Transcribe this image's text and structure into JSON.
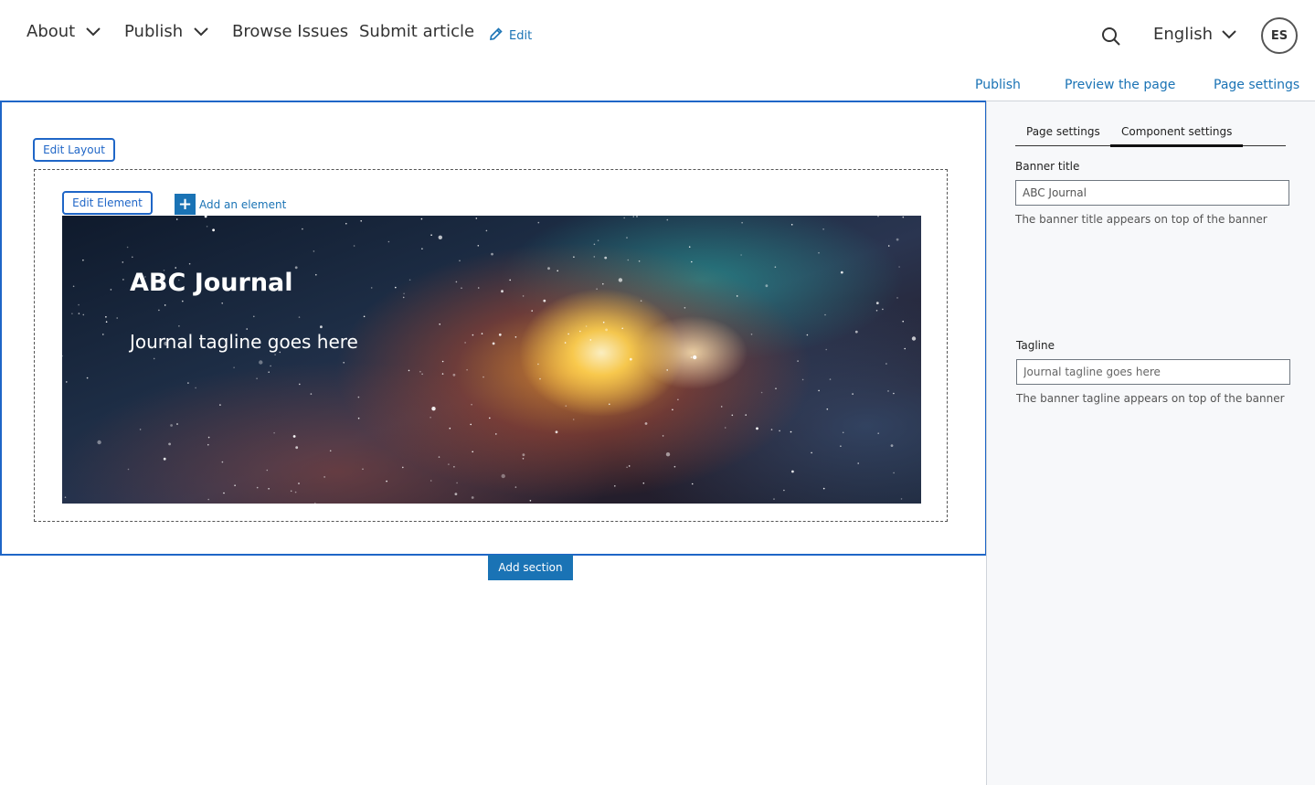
{
  "nav": {
    "about": "About",
    "publish": "Publish",
    "browse_issues": "Browse Issues",
    "submit_article": "Submit article",
    "edit": "Edit",
    "language": "English",
    "avatar_initials": "ES"
  },
  "page_actions": {
    "publish": "Publish",
    "preview": "Preview the page",
    "settings": "Page settings"
  },
  "editor": {
    "edit_layout": "Edit Layout",
    "edit_element": "Edit Element",
    "add_element": "Add an element",
    "add_section": "Add section",
    "banner": {
      "title": "ABC Journal",
      "tagline": "Journal tagline goes here"
    }
  },
  "panel": {
    "tabs": [
      {
        "label": "Page settings",
        "active": false
      },
      {
        "label": "Component settings",
        "active": true
      }
    ],
    "banner_title": {
      "label": "Banner title",
      "value": "ABC Journal",
      "help": "The banner title appears on top of the banner"
    },
    "tagline": {
      "label": "Tagline",
      "placeholder": "Journal tagline goes here",
      "help": "The banner tagline appears on top of the banner"
    }
  },
  "icons": {
    "chevron": "chevron-down-icon",
    "pencil": "pencil-icon",
    "search": "search-icon",
    "plus": "plus-icon"
  },
  "colors": {
    "accent": "#1a73b5",
    "selection_border": "#1f66c7",
    "panel_bg": "#f7f8fa"
  }
}
